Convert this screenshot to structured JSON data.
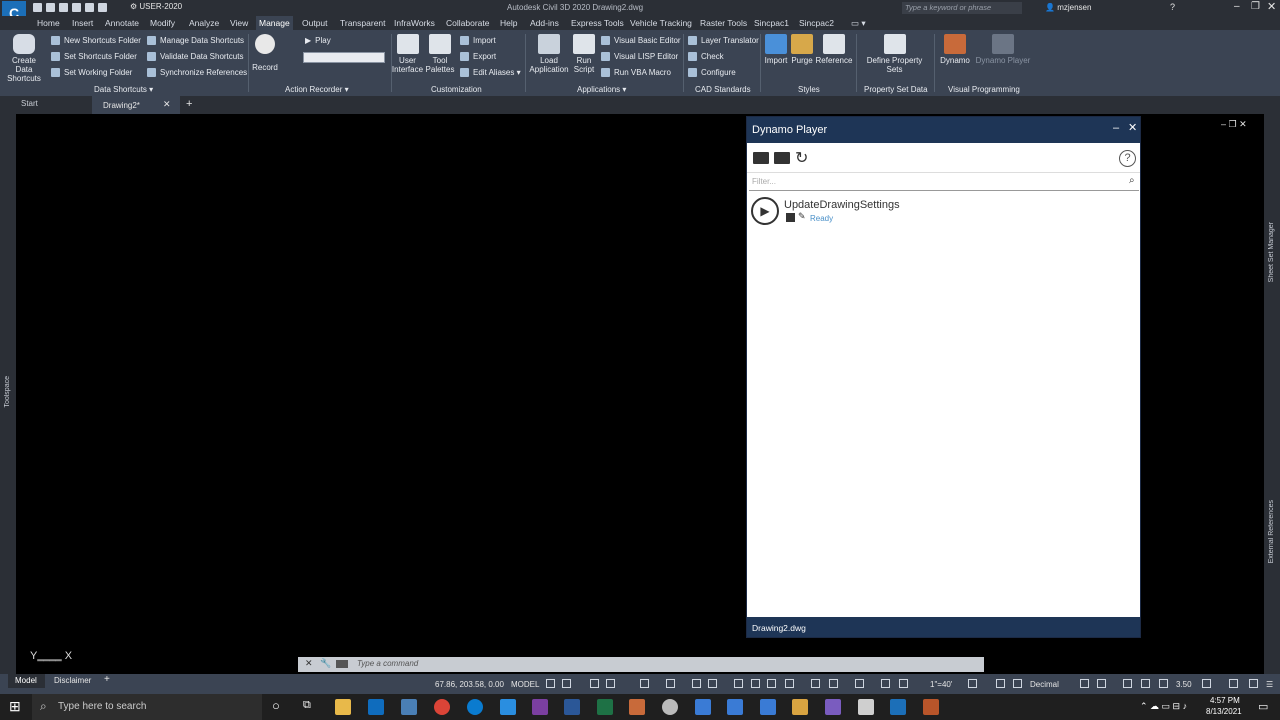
{
  "titlebar": {
    "workspace": "USER-2020",
    "app_title": "Autodesk Civil 3D 2020   Drawing2.dwg",
    "search_placeholder": "Type a keyword or phrase",
    "user": "mzjensen"
  },
  "menubar": {
    "items": [
      "Home",
      "Insert",
      "Annotate",
      "Modify",
      "Analyze",
      "View",
      "Manage",
      "Output",
      "Transparent",
      "InfraWorks",
      "Collaborate",
      "Help",
      "Add-ins",
      "Express Tools",
      "Vehicle Tracking",
      "Raster Tools",
      "Sincpac1",
      "Sincpac2"
    ],
    "active": "Manage"
  },
  "ribbon": {
    "data_shortcuts": {
      "create": "Create Data Shortcuts",
      "small": [
        "New Shortcuts Folder",
        "Set Shortcuts Folder",
        "Set Working Folder",
        "Manage Data Shortcuts",
        "Validate Data Shortcuts",
        "Synchronize References"
      ],
      "label": "Data Shortcuts ▾"
    },
    "action_recorder": {
      "record": "Record",
      "play": "Play",
      "label": "Action Recorder ▾"
    },
    "customization": {
      "user_interface": "User Interface",
      "tool_palettes": "Tool Palettes",
      "small": [
        "Import",
        "Export",
        "Edit Aliases ▾"
      ],
      "label": "Customization"
    },
    "applications": {
      "load": "Load Application",
      "run_script": "Run Script",
      "small": [
        "Visual Basic Editor",
        "Visual LISP Editor",
        "Run VBA Macro"
      ],
      "label": "Applications ▾"
    },
    "cad_standards": {
      "small": [
        "Layer Translator",
        "Check",
        "Configure"
      ],
      "label": "CAD Standards"
    },
    "styles": {
      "buttons": [
        "Import",
        "Purge",
        "Reference"
      ],
      "label": "Styles"
    },
    "property_set_data": {
      "button": "Define Property Sets",
      "label": "Property Set Data"
    },
    "visual_programming": {
      "dynamo": "Dynamo",
      "dynamo_player": "Dynamo Player",
      "label": "Visual Programming"
    }
  },
  "doc_tabs": {
    "start": "Start",
    "drawing": "Drawing2*"
  },
  "side_panels": {
    "left": "Toolspace",
    "right_top": "Sheet Set Manager",
    "right_bottom": "External References"
  },
  "dynamo_player": {
    "title": "Dynamo Player",
    "filter_placeholder": "Filter...",
    "script_name": "UpdateDrawingSettings",
    "script_status": "Ready",
    "footer": "Drawing2.dwg"
  },
  "command_line": {
    "placeholder": "Type a command"
  },
  "layout_tabs": {
    "model": "Model",
    "disclaimer": "Disclaimer"
  },
  "statusbar": {
    "coords": "67.86, 203.58, 0.00",
    "space": "MODEL",
    "scale": "1\"=40'",
    "units": "Decimal",
    "value": "3.50"
  },
  "taskbar": {
    "search_placeholder": "Type here to search",
    "time": "4:57 PM",
    "date": "8/13/2021"
  },
  "colors": {
    "dyn_header": "#1e3556",
    "ribbon": "#3b4453",
    "status_ready": "#4a90c8"
  }
}
